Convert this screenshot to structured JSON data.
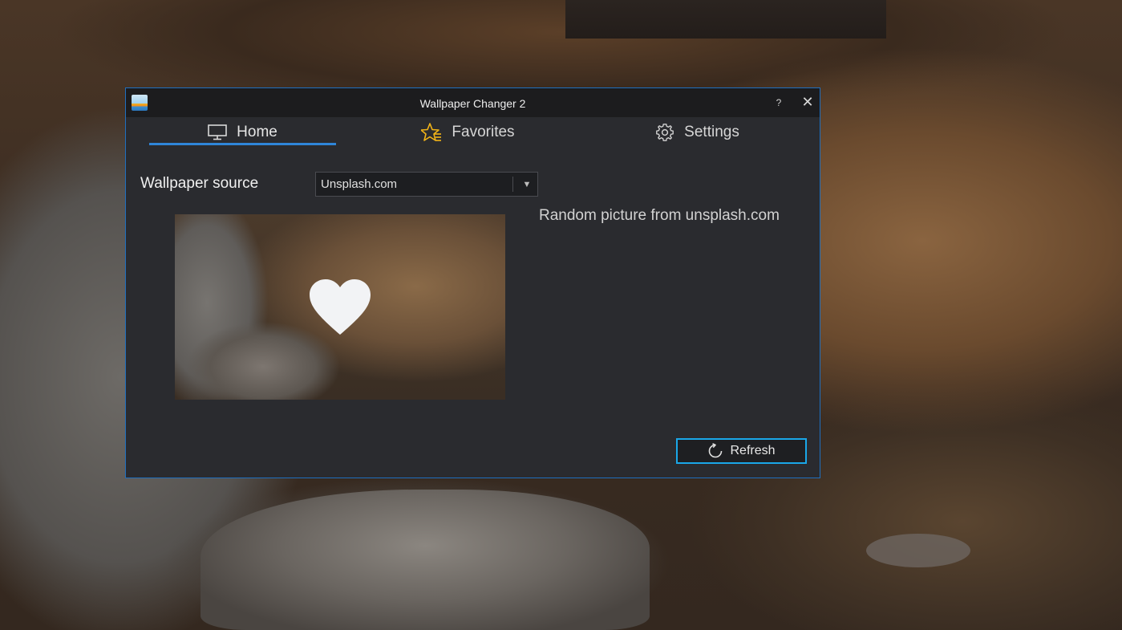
{
  "window": {
    "title": "Wallpaper Changer 2",
    "help_glyph": "?",
    "close_glyph": "✕"
  },
  "tabs": [
    {
      "label": "Home",
      "icon": "monitor-icon",
      "active": true
    },
    {
      "label": "Favorites",
      "icon": "star-list-icon",
      "active": false
    },
    {
      "label": "Settings",
      "icon": "gear-icon",
      "active": false
    }
  ],
  "home": {
    "source_label": "Wallpaper source",
    "source_value": "Unsplash.com",
    "description": "Random picture from unsplash.com",
    "refresh_label": "Refresh"
  },
  "colors": {
    "accent": "#2f86d9",
    "button_border": "#1aa7e8",
    "favorites_star": "#f2b418"
  }
}
